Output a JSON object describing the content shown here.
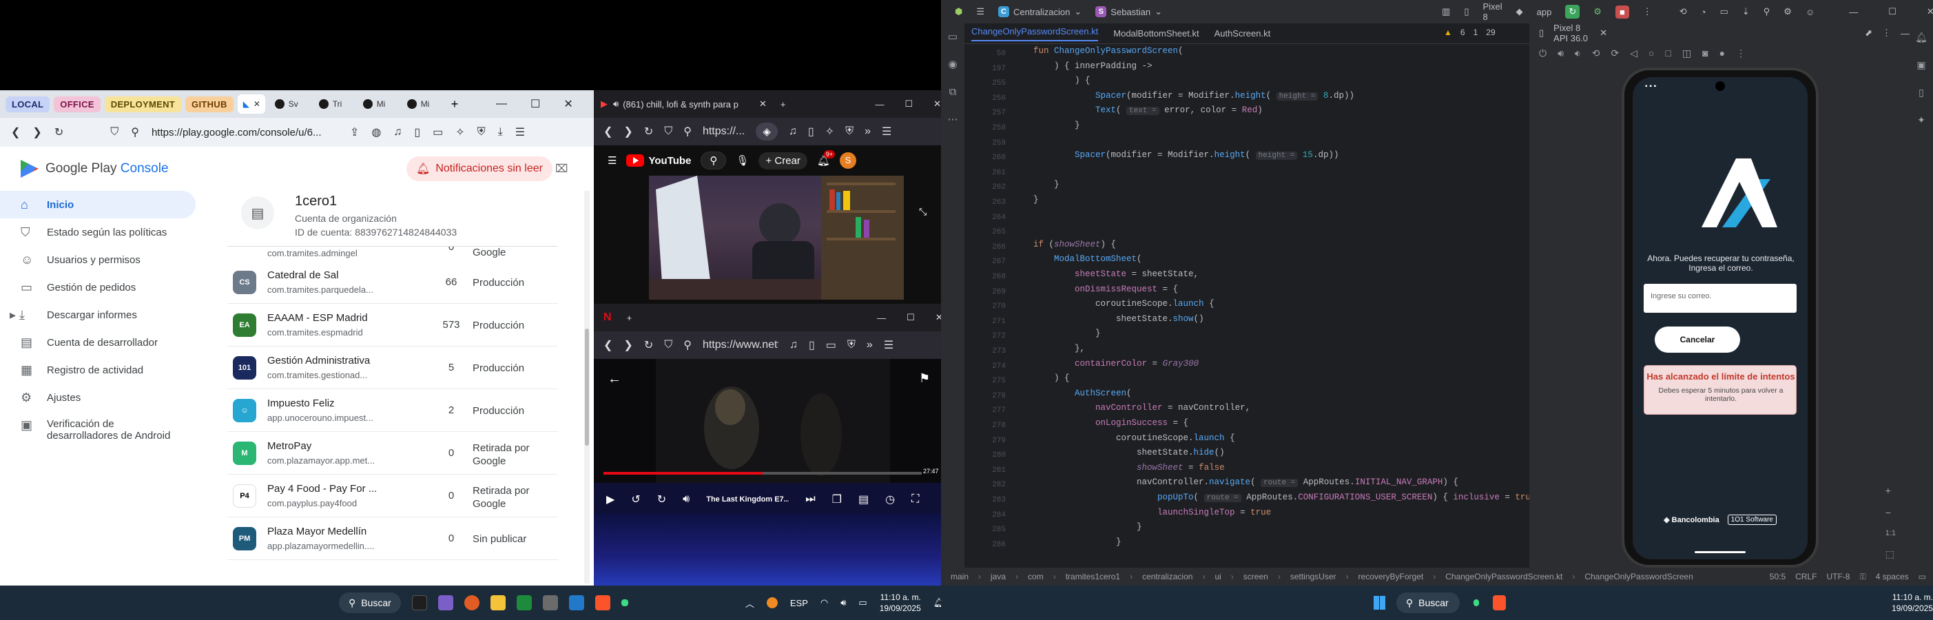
{
  "play_console": {
    "tab_groups": [
      {
        "label": "LOCAL",
        "bg": "#c7d2f7",
        "fg": "#1b2a6b"
      },
      {
        "label": "OFFICE",
        "bg": "#f3c3d8",
        "fg": "#7a1446"
      },
      {
        "label": "DEPLOYMENT",
        "bg": "#f8e39a",
        "fg": "#5c4900"
      },
      {
        "label": "GITHUB",
        "bg": "#f9d09c",
        "fg": "#6b3b00"
      }
    ],
    "mini_tabs": [
      "Sv",
      "Tri",
      "Mi",
      "Mi"
    ],
    "url": "https://play.google.com/console/u/6...",
    "brand_main": "Google Play",
    "brand_accent": "Console",
    "notifications_label": "Notificaciones sin leer",
    "sidebar": [
      {
        "label": "Inicio",
        "icon": "home-icon",
        "glyph": "⌂",
        "active": true
      },
      {
        "label": "Estado según las políticas",
        "icon": "shield-icon",
        "glyph": "⛉",
        "active": false
      },
      {
        "label": "Usuarios y permisos",
        "icon": "users-icon",
        "glyph": "☺",
        "active": false
      },
      {
        "label": "Gestión de pedidos",
        "icon": "card-icon",
        "glyph": "▭",
        "active": false
      },
      {
        "label": "Descargar informes",
        "icon": "download-icon",
        "glyph": "⤓",
        "active": false
      },
      {
        "label": "Cuenta de desarrollador",
        "icon": "account-icon",
        "glyph": "▤",
        "active": false
      },
      {
        "label": "Registro de actividad",
        "icon": "log-icon",
        "glyph": "▦",
        "active": false
      },
      {
        "label": "Ajustes",
        "icon": "gear-icon",
        "glyph": "⚙",
        "active": false
      },
      {
        "label": "Verificación de desarrolladores de Android",
        "icon": "verify-icon",
        "glyph": "▣",
        "active": false
      }
    ],
    "org": {
      "name": "1cero1",
      "type": "Cuenta de organización",
      "id": "ID de cuenta: 8839762714824844033"
    },
    "partial_row": {
      "pkg": "com.tramites.admingel",
      "count": "0",
      "status": "Google"
    },
    "apps": [
      {
        "name": "Catedral de Sal",
        "pkg": "com.tramites.parquedela...",
        "count": "66",
        "status": "Producción",
        "color": "#6c7a89",
        "abbr": "CS"
      },
      {
        "name": "EAAAM - ESP Madrid",
        "pkg": "com.tramites.espmadrid",
        "count": "573",
        "status": "Producción",
        "color": "#2e7d32",
        "abbr": "EA"
      },
      {
        "name": "Gestión Administrativa",
        "pkg": "com.tramites.gestionad...",
        "count": "5",
        "status": "Producción",
        "color": "#1a2a5e",
        "abbr": "101"
      },
      {
        "name": "Impuesto Feliz",
        "pkg": "app.unocerouno.impuest...",
        "count": "2",
        "status": "Producción",
        "color": "#26a6d1",
        "abbr": "☺"
      },
      {
        "name": "MetroPay",
        "pkg": "com.plazamayor.app.met...",
        "count": "0",
        "status": "Retirada por Google",
        "color": "#2bb673",
        "abbr": "M"
      },
      {
        "name": "Pay 4 Food - Pay For ...",
        "pkg": "com.payplus.pay4food",
        "count": "0",
        "status": "Retirada por Google",
        "color": "#ffffff",
        "abbr": "P4"
      },
      {
        "name": "Plaza Mayor Medellín",
        "pkg": "app.plazamayormedellin....",
        "count": "0",
        "status": "Sin publicar",
        "color": "#1e5a7a",
        "abbr": "PM"
      }
    ]
  },
  "youtube": {
    "tab_title": "(861) chill, lofi & synth para p",
    "url": "https://...",
    "logo": "YouTube",
    "create_label": "+ Crear",
    "notif_count": "9+"
  },
  "netflix": {
    "url": "https://www.netf",
    "title": "The Last Kingdom E7...",
    "time_left": "27:47",
    "progress": 0.5
  },
  "ide": {
    "project": "Centralizacion",
    "user": "Sebastian",
    "device": "Pixel 8",
    "run_config": "app",
    "tabs": [
      "ChangeOnlyPasswordScreen.kt",
      "ModalBottomSheet.kt",
      "AuthScreen.kt"
    ],
    "emulator_title": "Pixel 8 API 36.0",
    "inspections": {
      "warnings": "6",
      "weak": "1",
      "typos": "29"
    },
    "line_numbers": [
      "50",
      "197",
      "255",
      "256",
      "257",
      "258",
      "259",
      "260",
      "261",
      "262",
      "263",
      "264",
      "265",
      "266",
      "267",
      "268",
      "269",
      "270",
      "271",
      "272",
      "273",
      "274",
      "275",
      "276",
      "277",
      "278",
      "279",
      "280",
      "281",
      "282",
      "283",
      "284",
      "285",
      "286"
    ],
    "breadcrumb": [
      "main",
      "java",
      "com",
      "tramites1cero1",
      "centralizacion",
      "ui",
      "screen",
      "settingsUser",
      "recoveryByForget",
      "ChangeOnlyPasswordScreen.kt",
      "ChangeOnlyPasswordScreen"
    ],
    "status": {
      "position": "50:5",
      "line_sep": "CRLF",
      "encoding": "UTF-8",
      "indent": "4 spaces"
    }
  },
  "app_screen": {
    "prompt": "Ahora. Puedes recuperar tu contraseña, Ingresa el correo.",
    "email_placeholder": "Ingrese su correo.",
    "cancel_label": "Cancelar",
    "alert_title": "Has alcanzado el límite de intentos",
    "alert_body": "Debes esperar 5 minutos para volver a intentarlo.",
    "brand1": "Bancolombia",
    "brand2": "Software"
  },
  "taskbar": {
    "search_label": "Buscar",
    "lang": "ESP",
    "time": "11:10 a. m.",
    "date": "19/09/2025"
  }
}
